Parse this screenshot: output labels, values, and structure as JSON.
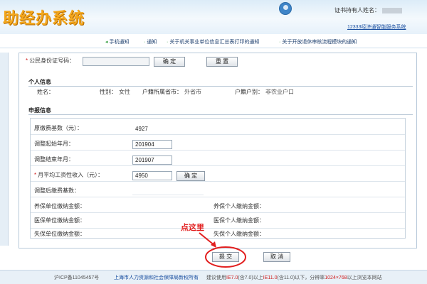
{
  "header": {
    "system_title": "助经办系统",
    "holder_label": "证书持有人姓名：",
    "service_link": "12333经济通智能服务系统"
  },
  "notice_bar": {
    "items": [
      "手机通知",
      "通知",
      "关于机关事业单位信息汇总表打印的通知",
      "关于开放退休审核流程模块的通知"
    ]
  },
  "id_section": {
    "label": "公民身份证号码：",
    "input_value": "",
    "confirm_label": "确 定",
    "reset_label": "重 置"
  },
  "personal": {
    "title": "个人信息",
    "name_label": "姓名：",
    "name_value": "",
    "gender_label": "性别：",
    "gender_value": "女性",
    "hukou_city_label": "户籍所属省市：",
    "hukou_city_value": "外省市",
    "hukou_type_label": "户籍户别：",
    "hukou_type_value": "非农业户口"
  },
  "declaration": {
    "title": "申报信息",
    "rows": {
      "orig_base_label": "原缴费基数（元）：",
      "orig_base_value": "4927",
      "start_label": "调整起始年月：",
      "start_value": "201904",
      "end_label": "调整结束年月：",
      "end_value": "201907",
      "income_label": "月平均工资性收入（元）：",
      "income_value": "4950",
      "income_confirm": "确 定",
      "adjusted_label": "调整后缴费基数：",
      "pension_unit_label": "养保单位缴纳金额：",
      "pension_personal_label": "养保个人缴纳金额：",
      "medical_unit_label": "医保单位缴纳金额：",
      "medical_personal_label": "医保个人缴纳金额：",
      "unemp_unit_label": "失保单位缴纳金额：",
      "unemp_personal_label": "失保个人缴纳金额："
    }
  },
  "actions": {
    "callout": "点这里",
    "submit_label": "提 交",
    "cancel_label": "取 消"
  },
  "footer": {
    "icp": "沪ICP备11045457号",
    "owner": "上海市人力资源和社会保障局新权所有",
    "browser_prefix": "建议使用",
    "ie7": "IE7.0",
    "ie7_note": "(含7.0)以上",
    "ie11": "IE11.0",
    "ie11_note": "(含11.0)以下，分辨率",
    "resolution": "1024×768",
    "resolution_suffix": "以上浏览本网站"
  },
  "colors": {
    "title_orange": "#f4a81e",
    "link_blue": "#1a4fa0",
    "highlight_red": "#e21f1f"
  }
}
